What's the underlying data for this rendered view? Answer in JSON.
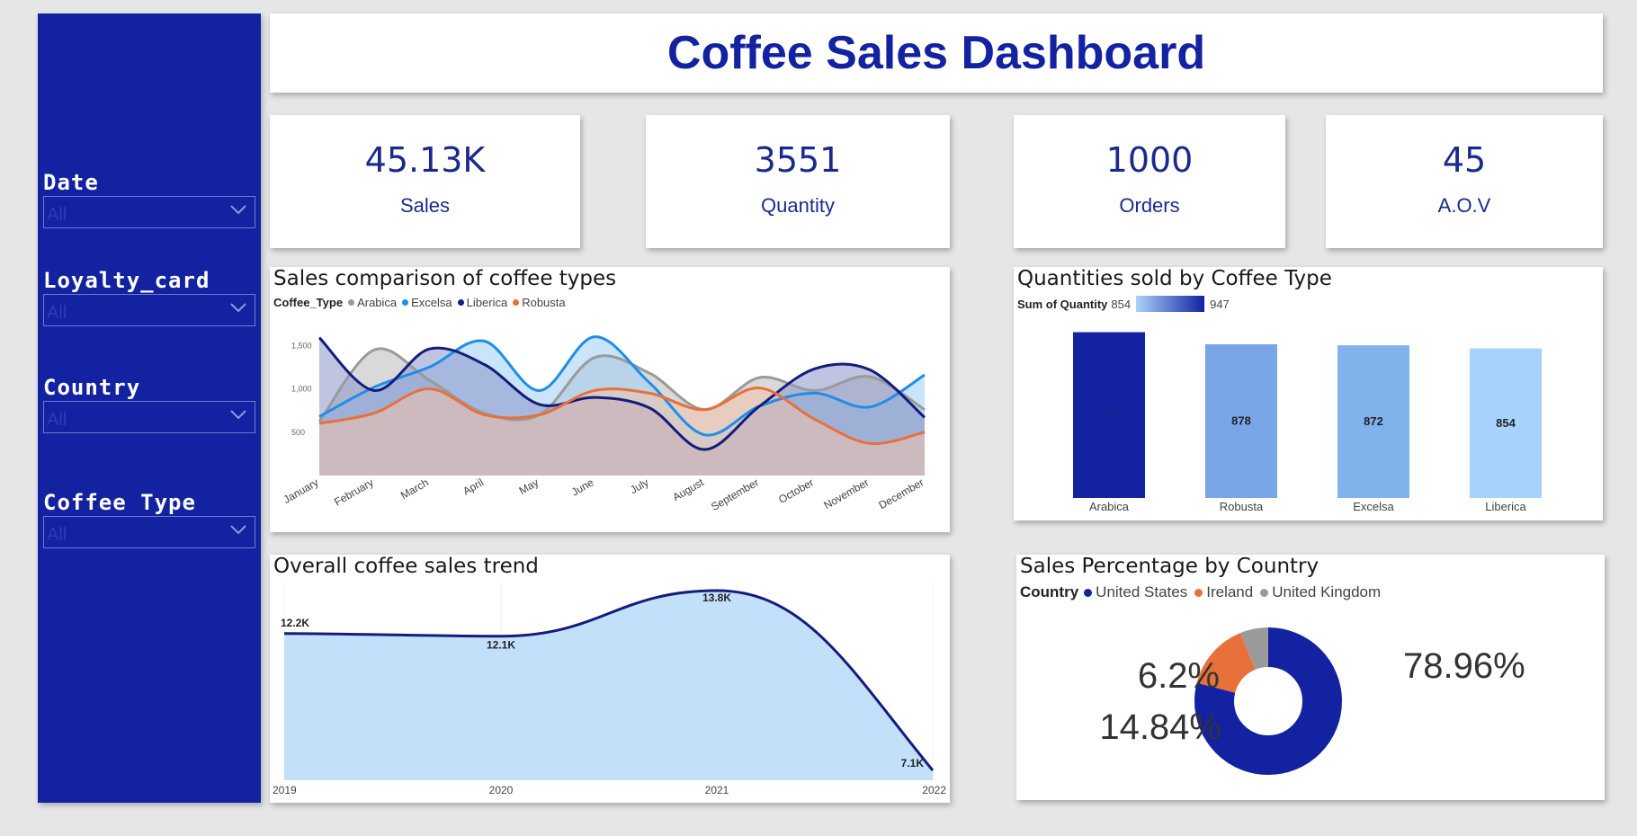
{
  "header": {
    "title": "Coffee Sales Dashboard"
  },
  "slicers": [
    {
      "label": "Date",
      "value": "All"
    },
    {
      "label": "Loyalty_card",
      "value": "All"
    },
    {
      "label": "Country",
      "value": "All"
    },
    {
      "label": "Coffee Type",
      "value": "All"
    }
  ],
  "kpis": [
    {
      "value": "45.13K",
      "label": "Sales"
    },
    {
      "value": "3551",
      "label": "Quantity"
    },
    {
      "value": "1000",
      "label": "Orders"
    },
    {
      "value": "45",
      "label": "A.O.V"
    }
  ],
  "colors": {
    "accent": "#1222a0",
    "arabica": "#9a9a9a",
    "excelsa": "#1f8ee8",
    "liberica": "#141c7c",
    "robusta": "#e8703a"
  },
  "chart_data": [
    {
      "type": "area",
      "title": "Sales comparison of coffee types",
      "legend_title": "Coffee_Type",
      "legend_placement": "top-left",
      "categories": [
        "January",
        "February",
        "March",
        "April",
        "May",
        "June",
        "July",
        "August",
        "September",
        "October",
        "November",
        "December"
      ],
      "y_ticks": [
        "500",
        "1,000",
        "1,500"
      ],
      "ylim": [
        0,
        1700
      ],
      "series": [
        {
          "name": "Arabica",
          "color": "#9a9a9a",
          "fill": "#b9b9b9",
          "values": [
            620,
            1450,
            1100,
            720,
            700,
            1360,
            1180,
            760,
            1130,
            980,
            1140,
            760
          ]
        },
        {
          "name": "Excelsa",
          "color": "#1f8ee8",
          "fill": "#9fcdf4",
          "values": [
            680,
            1020,
            1250,
            1550,
            980,
            1600,
            1070,
            470,
            800,
            950,
            790,
            1160
          ]
        },
        {
          "name": "Liberica",
          "color": "#141c7c",
          "fill": "#8a93c9",
          "values": [
            1590,
            980,
            1460,
            1280,
            820,
            900,
            780,
            300,
            800,
            1230,
            1220,
            670
          ]
        },
        {
          "name": "Robusta",
          "color": "#e8703a",
          "fill": "#f2c3a9",
          "values": [
            600,
            720,
            1000,
            700,
            700,
            980,
            950,
            760,
            1010,
            650,
            370,
            500
          ]
        }
      ]
    },
    {
      "type": "bar",
      "title": "Quantities sold by Coffee Type",
      "legend_title": "Sum of Quantity",
      "legend_min": "854",
      "legend_max": "947",
      "categories": [
        "Arabica",
        "Robusta",
        "Excelsa",
        "Liberica"
      ],
      "values": [
        947,
        878,
        872,
        854
      ],
      "value_labels": [
        "947",
        "878",
        "872",
        "854"
      ],
      "colors": [
        "#1222a0",
        "#7aa5e7",
        "#80b2eb",
        "#a5d3fb"
      ],
      "ylim": [
        0,
        960
      ]
    },
    {
      "type": "area",
      "title": "Overall coffee sales trend",
      "categories": [
        "2019",
        "2020",
        "2021",
        "2022"
      ],
      "values": [
        12.2,
        12.1,
        13.8,
        7.1
      ],
      "value_labels": [
        "12.2K",
        "12.1K",
        "13.8K",
        "7.1K"
      ],
      "ylim": [
        7.1,
        13.8
      ],
      "line_color": "#141c7c",
      "fill_color": "#c3e0fb"
    },
    {
      "type": "pie",
      "title": "Sales Percentage by Country",
      "legend_title": "Country",
      "legend_placement": "top-left",
      "slices": [
        {
          "name": "United States",
          "value": 78.96,
          "label": "78.96%",
          "color": "#1222a0"
        },
        {
          "name": "Ireland",
          "value": 14.84,
          "label": "14.84%",
          "color": "#e8703a"
        },
        {
          "name": "United Kingdom",
          "value": 6.2,
          "label": "6.2%",
          "color": "#9a9a9a"
        }
      ]
    }
  ]
}
